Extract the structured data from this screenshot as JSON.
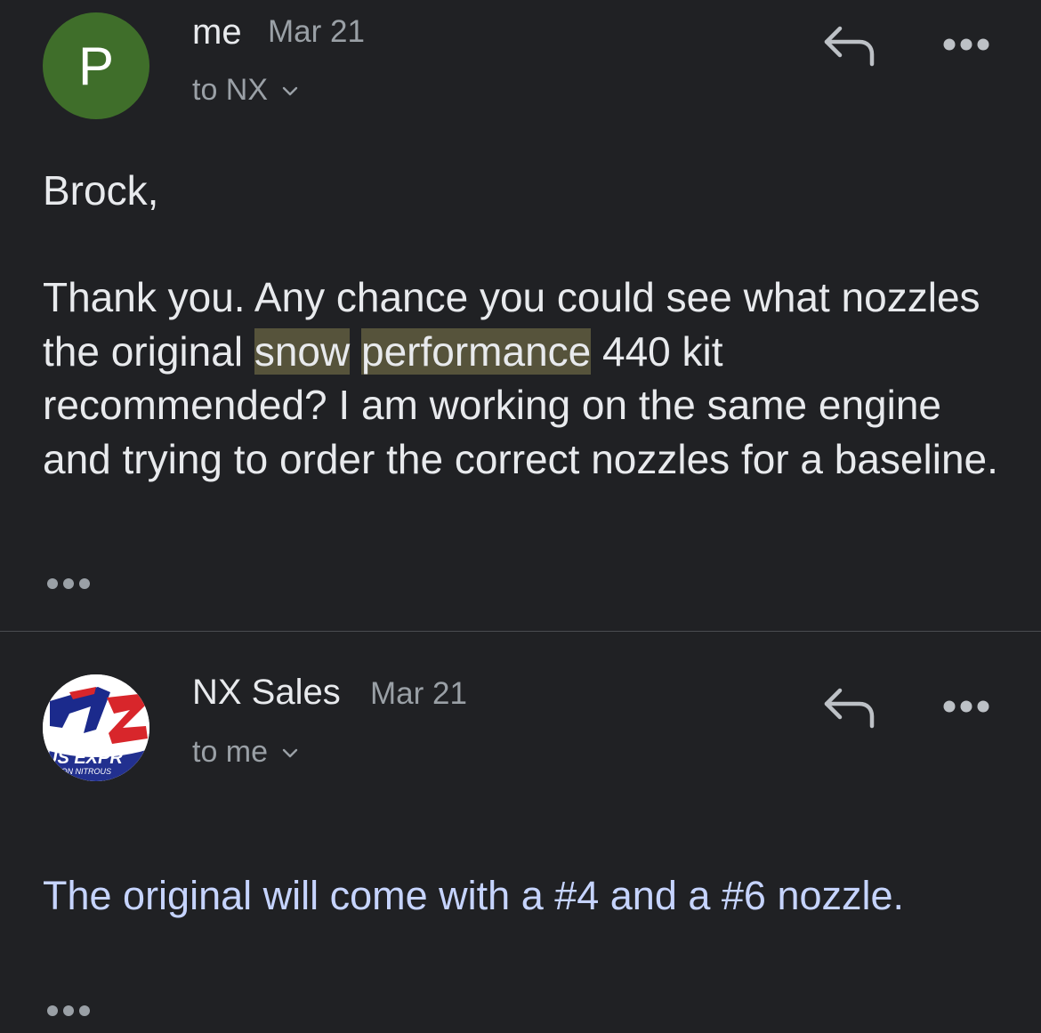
{
  "messages": [
    {
      "avatar_letter": "P",
      "avatar_color": "#3f6e2a",
      "sender": "me",
      "date": "Mar 21",
      "recipient": "to NX",
      "greeting": "Brock,",
      "body_part1": "Thank you. Any chance you could see what nozzles the original ",
      "highlight1": "snow",
      "highlight2": "performance",
      "body_part2": " 440 kit recommended? I am working on the same engine and trying to order the correct nozzles for a baseline."
    },
    {
      "avatar_logo_text": "US EXPR",
      "avatar_logo_subtext": "ION NITROUS",
      "sender": "NX Sales",
      "date": "Mar 21",
      "recipient": "to me",
      "body": "The original will come with a #4 and a #6 nozzle."
    }
  ],
  "icons": {
    "reply": "reply-icon",
    "more": "more-options-icon",
    "chevron": "chevron-down-icon",
    "trimmed": "show-trimmed-content-icon"
  },
  "colors": {
    "background": "#202124",
    "highlight": "#56533b",
    "reply_text": "#c6d4ff"
  }
}
